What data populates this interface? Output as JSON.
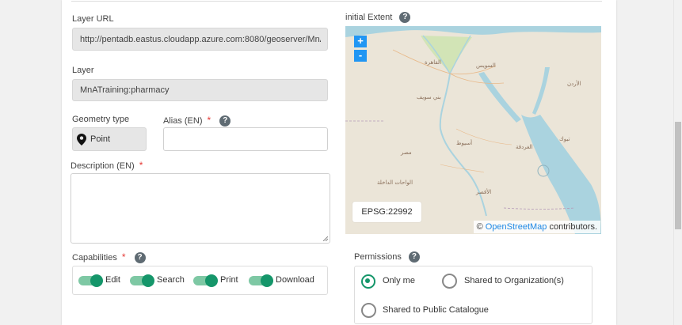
{
  "layer_url": {
    "label": "Layer URL",
    "value": "http://pentadb.eastus.cloudapp.azure.com:8080/geoserver/MnATr"
  },
  "layer": {
    "label": "Layer",
    "value": "MnATraining:pharmacy"
  },
  "geometry": {
    "label": "Geometry type",
    "value": "Point"
  },
  "alias": {
    "label": "Alias (EN)",
    "value": "",
    "required_mark": "*"
  },
  "description": {
    "label": "Description (EN)",
    "value": "",
    "required_mark": "*"
  },
  "extent": {
    "label": "initial Extent",
    "zoom_in": "+",
    "zoom_out": "-",
    "projection": "EPSG:22992",
    "attribution_prefix": "©",
    "attribution_link": "OpenStreetMap",
    "attribution_suffix": "contributors."
  },
  "capabilities": {
    "label": "Capabilities",
    "required_mark": "*",
    "items": [
      {
        "label": "Edit",
        "on": true
      },
      {
        "label": "Search",
        "on": true
      },
      {
        "label": "Print",
        "on": true
      },
      {
        "label": "Download",
        "on": true
      }
    ]
  },
  "permissions": {
    "label": "Permissions",
    "options": [
      {
        "label": "Only me",
        "selected": true
      },
      {
        "label": "Shared to Organization(s)",
        "selected": false
      },
      {
        "label": "Shared to Public Catalogue",
        "selected": false
      }
    ]
  },
  "help_glyph": "?",
  "colors": {
    "accent": "#15966a",
    "link": "#1e88e5",
    "required": "#e53935",
    "map_zoom": "#2196f3"
  }
}
